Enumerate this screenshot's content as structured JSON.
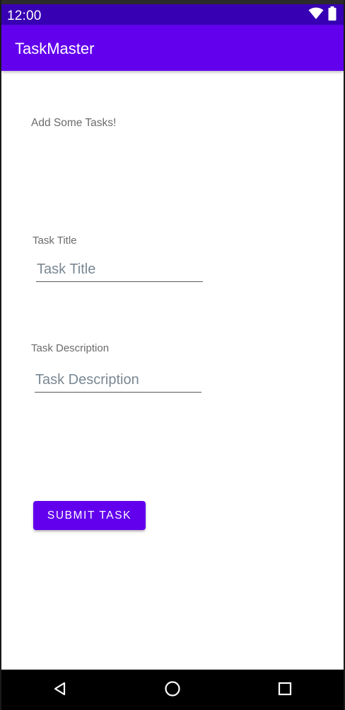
{
  "status_bar": {
    "time": "12:00",
    "icons": [
      "wifi-icon",
      "battery-icon"
    ],
    "color": "#3700b3"
  },
  "app_bar": {
    "title": "TaskMaster",
    "color": "#6200ee"
  },
  "main": {
    "heading": "Add Some Tasks!",
    "task_title": {
      "label": "Task Title",
      "placeholder": "Task Title",
      "value": ""
    },
    "task_description": {
      "label": "Task Description",
      "placeholder": "Task Description",
      "value": ""
    },
    "submit_label": "SUBMIT TASK",
    "accent": "#6200ee"
  },
  "nav_bar": {
    "buttons": [
      "back-icon",
      "home-icon",
      "recents-icon"
    ]
  }
}
